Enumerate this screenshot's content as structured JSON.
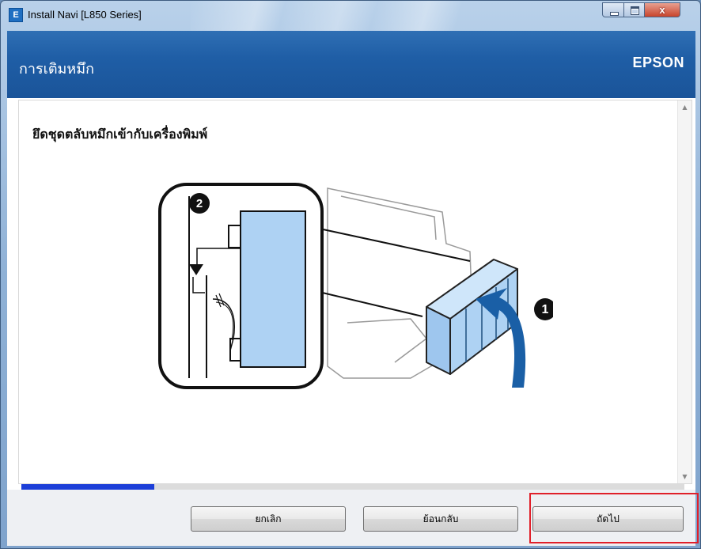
{
  "window": {
    "title": "Install Navi [L850 Series]",
    "app_icon_letter": "E",
    "close_glyph": "x"
  },
  "header": {
    "title": "การเติมหมึก",
    "brand": "EPSON"
  },
  "content": {
    "instruction": "ยึดชุดตลับหมึกเข้ากับเครื่องพิมพ์",
    "step_badges": [
      "1",
      "2"
    ]
  },
  "progress": {
    "fraction": 0.2
  },
  "buttons": {
    "cancel": "ยกเลิก",
    "back": "ย้อนกลับ",
    "next": "ถัดไป"
  },
  "colors": {
    "header_blue": "#1f5ea6",
    "progress_blue": "#1c3fd8",
    "ink_tank_blue": "#aed2f3",
    "arrow_blue": "#1a5fa6",
    "highlight_red": "#e0202a"
  },
  "icons": {
    "app": "epson-app-icon",
    "minimize": "minimize-icon",
    "maximize": "maximize-icon",
    "close": "close-icon",
    "scroll_up": "scroll-up-arrow-icon",
    "scroll_down": "scroll-down-arrow-icon"
  }
}
